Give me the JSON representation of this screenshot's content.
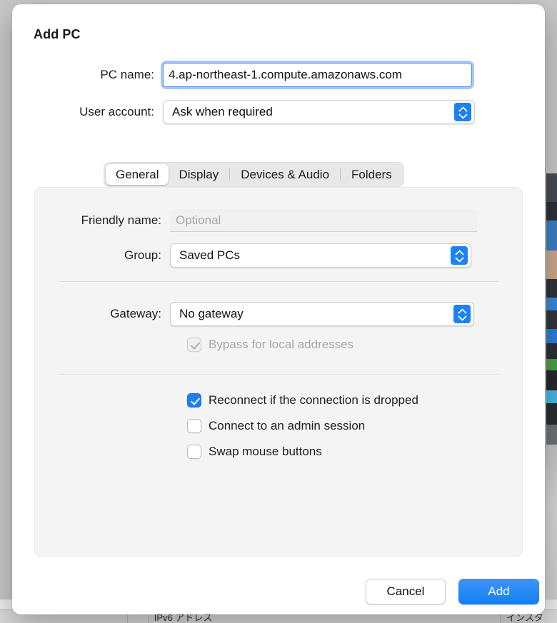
{
  "dialog": {
    "title": "Add PC",
    "top_fields": [
      {
        "label": "PC name:",
        "value": "4.ap-northeast-1.compute.amazonaws.com",
        "type": "textfield",
        "focused": true
      },
      {
        "label": "User account:",
        "value": "Ask when required",
        "type": "popup"
      }
    ],
    "tabs": [
      {
        "label": "General",
        "selected": true
      },
      {
        "label": "Display",
        "selected": false
      },
      {
        "label": "Devices & Audio",
        "selected": false
      },
      {
        "label": "Folders",
        "selected": false
      }
    ],
    "general": {
      "friendly_name": {
        "label": "Friendly name:",
        "value": "",
        "placeholder": "Optional"
      },
      "group": {
        "label": "Group:",
        "value": "Saved PCs"
      },
      "gateway": {
        "label": "Gateway:",
        "value": "No gateway"
      },
      "bypass": {
        "label": "Bypass for local addresses",
        "checked": true,
        "disabled": true
      },
      "options": [
        {
          "label": "Reconnect if the connection is dropped",
          "checked": true
        },
        {
          "label": "Connect to an admin session",
          "checked": false
        },
        {
          "label": "Swap mouse buttons",
          "checked": false
        }
      ]
    },
    "footer": {
      "cancel_label": "Cancel",
      "add_label": "Add"
    }
  },
  "background": {
    "table_columns": [
      "",
      "",
      "IPv6 アドレス",
      "インスタ"
    ]
  },
  "colors": {
    "accent_blue": "#1d7ff3",
    "focus_ring": "#5c96fa",
    "panel_bg": "#f4f4f4",
    "dialog_bg": "#ffffff",
    "text_primary": "#1d1d1d",
    "text_disabled": "#a9a9a9"
  }
}
